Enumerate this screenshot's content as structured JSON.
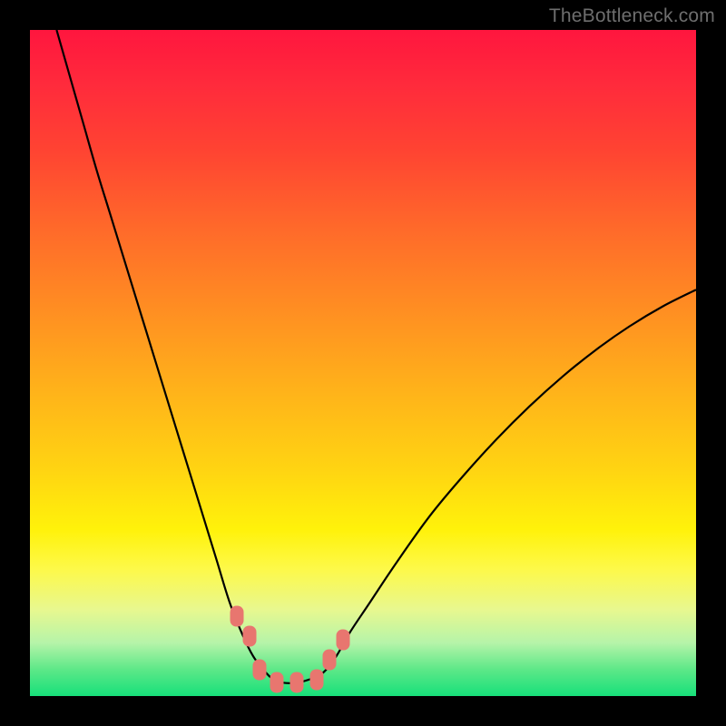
{
  "watermark": "TheBottleneck.com",
  "colors": {
    "background": "#000000",
    "gradient_top": "#ff163e",
    "gradient_bottom": "#17e07a",
    "curve": "#000000",
    "marker": "#e8766f"
  },
  "chart_data": {
    "type": "line",
    "title": "",
    "xlabel": "",
    "ylabel": "",
    "xlim": [
      0,
      100
    ],
    "ylim": [
      0,
      100
    ],
    "legend": false,
    "grid": false,
    "annotations": [
      "TheBottleneck.com"
    ],
    "series": [
      {
        "name": "curve-left",
        "x": [
          4,
          6,
          8,
          10,
          12,
          14,
          16,
          18,
          20,
          22,
          24,
          26,
          28,
          30,
          32,
          33.5,
          35,
          36.5,
          38
        ],
        "y": [
          100,
          93,
          86,
          79,
          72.5,
          66,
          59.5,
          53,
          46.5,
          40,
          33.5,
          27,
          20.5,
          14,
          9,
          6,
          4,
          2.5,
          2
        ]
      },
      {
        "name": "curve-right",
        "x": [
          38,
          40,
          42,
          44,
          46,
          48,
          51,
          55,
          60,
          65,
          70,
          75,
          80,
          85,
          90,
          95,
          100
        ],
        "y": [
          2,
          2,
          2.5,
          3.5,
          6,
          9.5,
          14,
          20,
          27,
          33,
          38.5,
          43.5,
          48,
          52,
          55.5,
          58.5,
          61
        ]
      },
      {
        "name": "markers",
        "type": "scatter",
        "x": [
          31,
          33,
          34.5,
          37,
          40,
          43,
          45,
          47
        ],
        "y": [
          12,
          9,
          4,
          2,
          2,
          2.5,
          5.5,
          8.5
        ]
      }
    ]
  }
}
